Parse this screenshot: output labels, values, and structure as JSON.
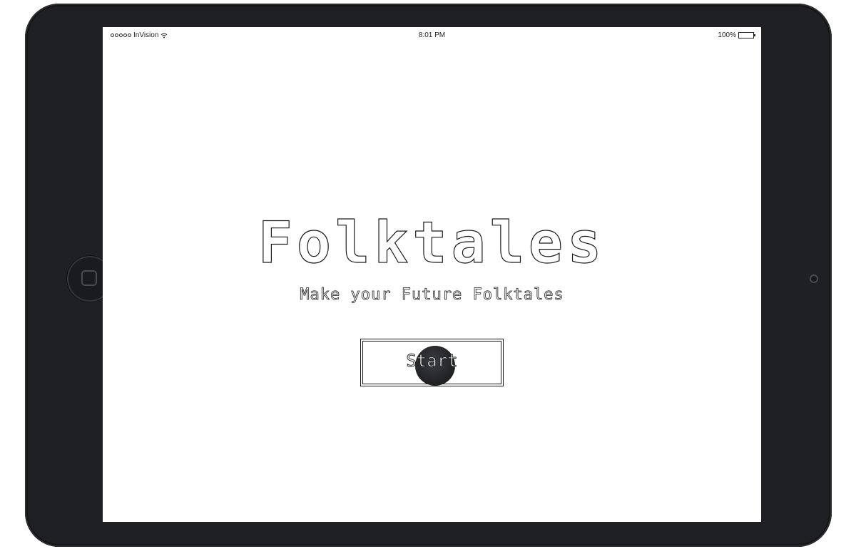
{
  "status_bar": {
    "carrier": "InVision",
    "time": "8:01 PM",
    "battery": "100%"
  },
  "main": {
    "title": "Folktales",
    "subtitle": "Make your Future Folktales",
    "start_label": "Start"
  },
  "icons": {
    "signal": "signal-dots-icon",
    "wifi": "wifi-icon",
    "battery": "battery-icon",
    "home": "home-button-icon",
    "camera": "camera-icon",
    "tap": "tap-indicator-icon"
  },
  "colors": {
    "device_frame": "#1f2023",
    "screen_bg": "#ffffff",
    "text_outline": "#1a1a1a"
  }
}
